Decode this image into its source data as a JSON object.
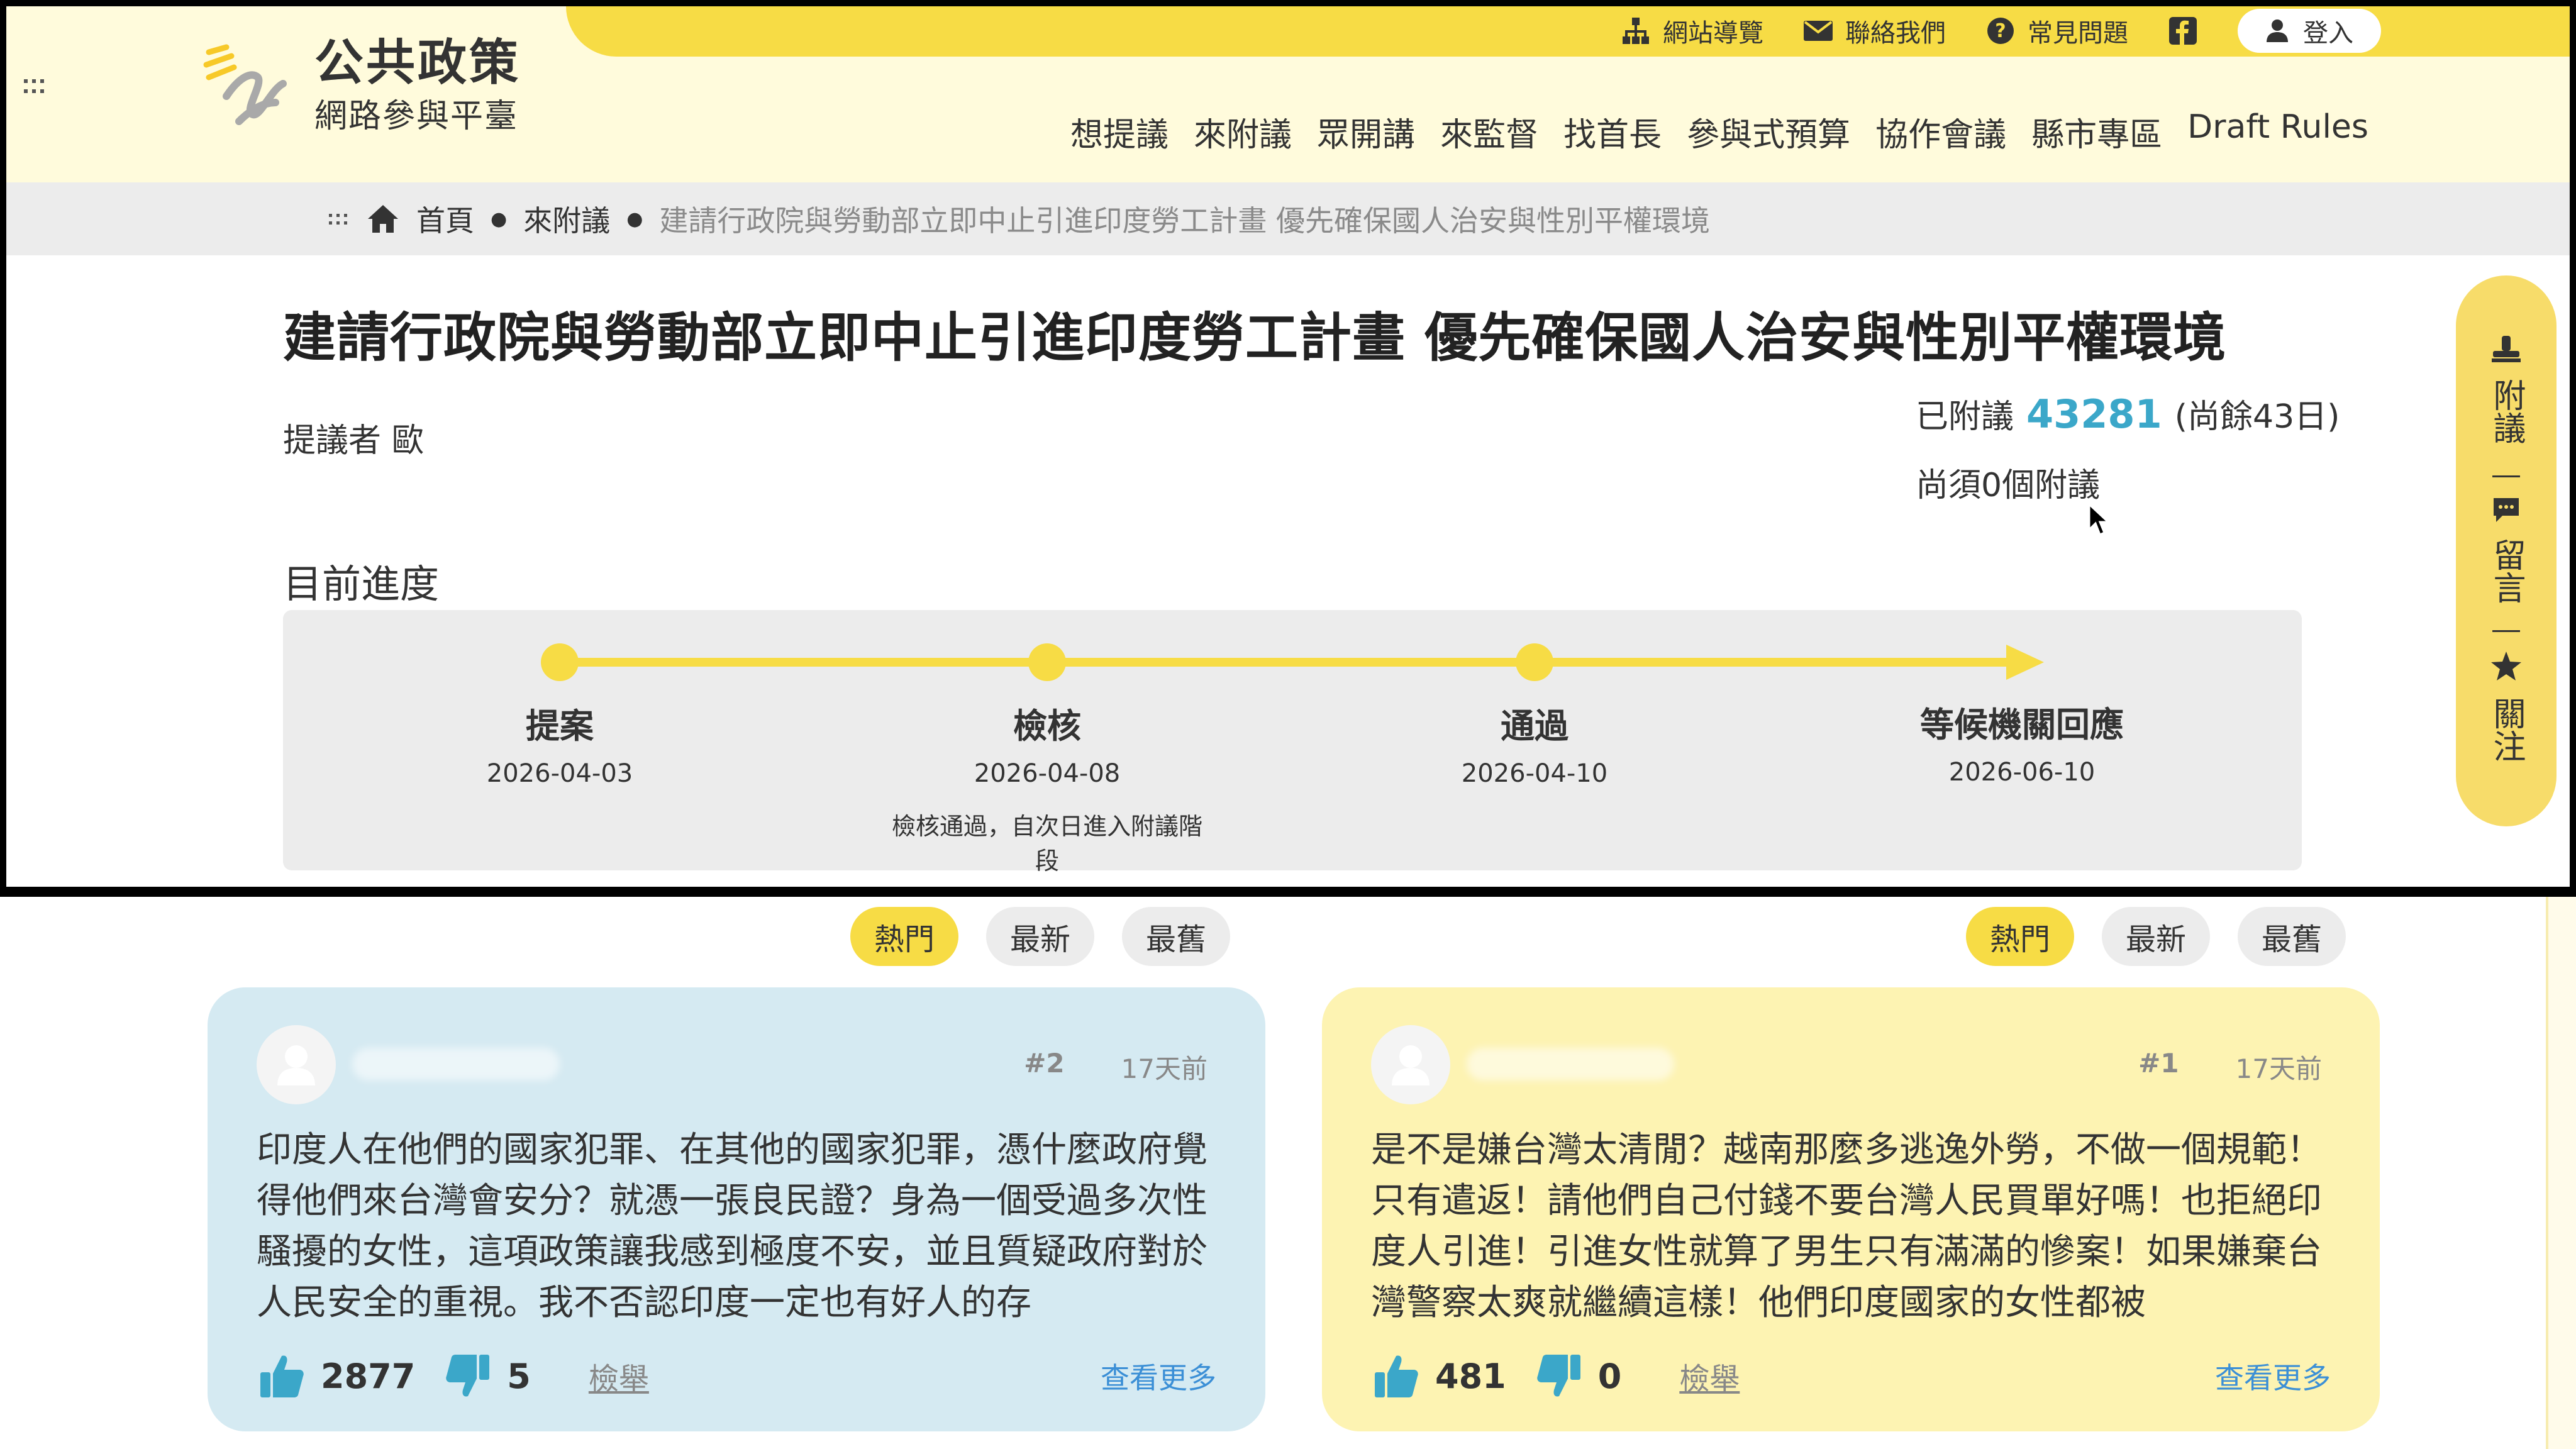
{
  "colors": {
    "accent_yellow": "#f7dc45",
    "header_bg": "#fffbdc",
    "link_blue": "#3ba7c9",
    "card_blue": "#d5eaf2",
    "card_yellow": "#fdf3b2"
  },
  "header": {
    "top_links": [
      {
        "icon": "sitemap-icon",
        "label": "網站導覽"
      },
      {
        "icon": "mail-icon",
        "label": "聯絡我們"
      },
      {
        "icon": "question-icon",
        "label": "常見問題"
      },
      {
        "icon": "facebook-icon",
        "label": ""
      }
    ],
    "login_label": "登入",
    "logo_line1": "公共政策",
    "logo_line2": "網路參與平臺",
    "nav": [
      "想提議",
      "來附議",
      "眾開講",
      "來監督",
      "找首長",
      "參與式預算",
      "協作會議",
      "縣市專區",
      "Draft Rules"
    ]
  },
  "breadcrumb": {
    "items": [
      "首頁",
      "來附議"
    ],
    "current": "建請行政院與勞動部立即中止引進印度勞工計畫 優先確保國人治安與性別平權環境"
  },
  "proposal": {
    "title": "建請行政院與勞動部立即中止引進印度勞工計畫 優先確保國人治安與性別平權環境",
    "proposer_label": "提議者",
    "proposer_name": "歐",
    "signatures_label": "已附議",
    "signatures_count": "43281",
    "remaining_days": "(尚餘43日)",
    "needed_text": "尚須0個附議"
  },
  "progress": {
    "label": "目前進度",
    "steps": [
      {
        "name": "提案",
        "date": "2026-04-03",
        "note": ""
      },
      {
        "name": "檢核",
        "date": "2026-04-08",
        "note": "檢核通過，自次日進入附議階段"
      },
      {
        "name": "通過",
        "date": "2026-04-10",
        "note": ""
      },
      {
        "name": "等候機關回應",
        "date": "2026-06-10",
        "note": ""
      }
    ]
  },
  "side_actions": [
    {
      "icon": "petition-icon",
      "label": "附議"
    },
    {
      "icon": "comment-icon",
      "label": "留言"
    },
    {
      "icon": "star-icon",
      "label": "關注"
    }
  ],
  "comments": {
    "left": {
      "tabs": [
        "熱門",
        "最新",
        "最舊"
      ],
      "active_tab": "熱門",
      "number": "#2",
      "time": "17天前",
      "text": "印度人在他們的國家犯罪、在其他的國家犯罪，憑什麼政府覺得他們來台灣會安分？就憑一張良民證？身為一個受過多次性騷擾的女性，這項政策讓我感到極度不安，並且質疑政府對於人民安全的重視。我不否認印度一定也有好人的存",
      "likes": "2877",
      "dislikes": "5",
      "report": "檢舉",
      "more": "查看更多"
    },
    "right": {
      "tabs": [
        "熱門",
        "最新",
        "最舊"
      ],
      "active_tab": "熱門",
      "number": "#1",
      "time": "17天前",
      "text": "是不是嫌台灣太清閒？越南那麼多逃逸外勞，不做一個規範！只有遣返！請他們自己付錢不要台灣人民買單好嗎！也拒絕印度人引進！引進女性就算了男生只有滿滿的慘案！如果嫌棄台灣警察太爽就繼續這樣！他們印度國家的女性都被",
      "likes": "481",
      "dislikes": "0",
      "report": "檢舉",
      "more": "查看更多"
    }
  }
}
